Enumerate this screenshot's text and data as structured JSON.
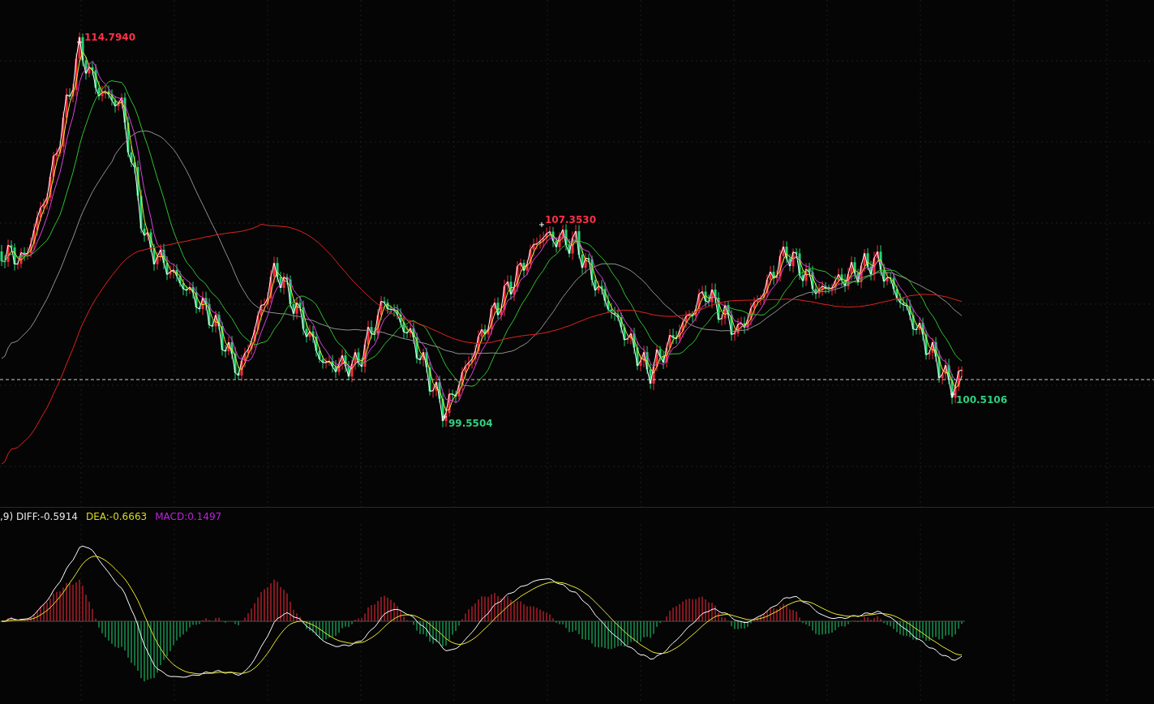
{
  "price_chart": {
    "annotations": [
      {
        "kind": "high",
        "text": "114.7940"
      },
      {
        "kind": "high",
        "text": "107.3530"
      },
      {
        "kind": "low",
        "text": "99.5504"
      },
      {
        "kind": "low",
        "text": "100.5106"
      }
    ]
  },
  "macd_panel": {
    "legend": [
      {
        "text": ",9) DIFF:-0.5914",
        "color": "#e6e6e6"
      },
      {
        "text": "DEA:-0.6663",
        "color": "#d8d820"
      },
      {
        "text": "MACD:0.1497",
        "color": "#c020e0"
      }
    ]
  }
}
